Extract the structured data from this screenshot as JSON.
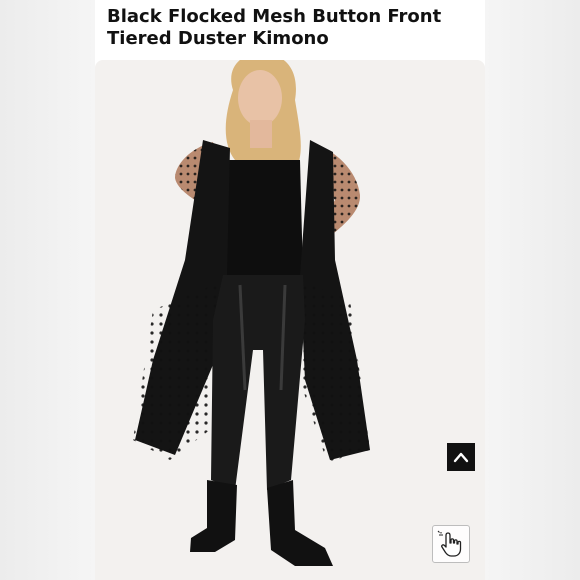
{
  "product": {
    "title": "Black Flocked Mesh Button Front Tiered Duster Kimono"
  },
  "icons": {
    "scroll_top": "chevron-up-icon",
    "cursor": "pointer-hand-icon"
  },
  "colors": {
    "panel": "#ffffff",
    "photo_background": "#f3f1ef",
    "garment": "#111111"
  }
}
